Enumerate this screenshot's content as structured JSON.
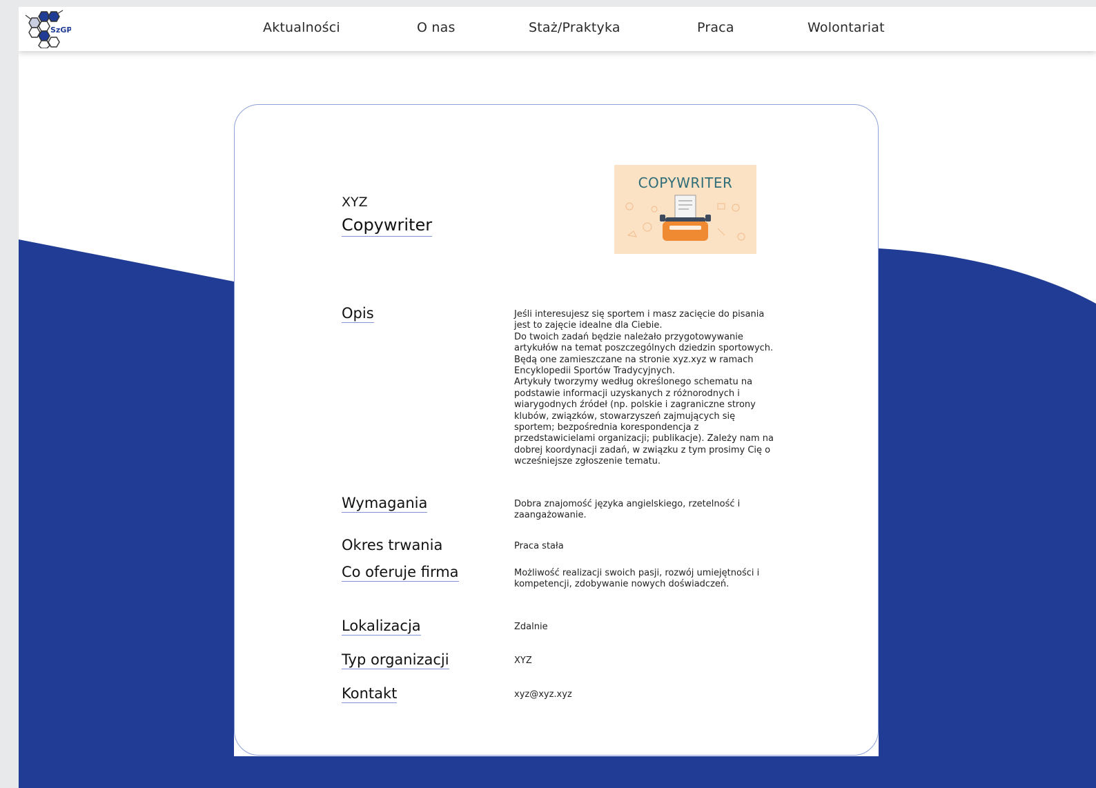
{
  "nav": {
    "logo_text": "SzGP",
    "items": [
      "Aktualności",
      "O nas",
      "Staż/Praktyka",
      "Praca",
      "Wolontariat"
    ]
  },
  "colors": {
    "brand_blue": "#203c94",
    "underline": "#7f93d4",
    "card_border": "#8fa0d8"
  },
  "offer": {
    "company": "XYZ",
    "title": "Copywriter",
    "image_text": "COPYWRITER",
    "sections": [
      {
        "label": "Opis",
        "value": "Jeśli interesujesz się sportem i masz zacięcie do pisania jest to zajęcie idealne dla Ciebie.\nDo twoich zadań będzie należało przygotowywanie artykułów na temat poszczególnych dziedzin sportowych. Będą one zamieszczane na stronie xyz.xyz w ramach Encyklopedii Sportów Tradycyjnych.\nArtykuły tworzymy według określonego schematu na podstawie informacji uzyskanych z różnorodnych i wiarygodnych źródeł (np. polskie i zagraniczne strony klubów, związków, stowarzyszeń zajmujących się sportem; bezpośrednia korespondencja z przedstawicielami organizacji; publikacje). Zależy nam na dobrej koordynacji zadań, w związku z tym prosimy Cię o wcześniejsze zgłoszenie tematu."
      },
      {
        "label": "Wymagania",
        "value": "Dobra znajomość języka angielskiego, rzetelność i zaangażowanie."
      },
      {
        "label": "Okres trwania",
        "value": "Praca stała"
      },
      {
        "label": "Co oferuje firma",
        "value": "Możliwość realizacji swoich pasji, rozwój umiejętności i kompetencji, zdobywanie nowych doświadczeń."
      },
      {
        "label": "Lokalizacja",
        "value": "Zdalnie"
      },
      {
        "label": "Typ organizacji",
        "value": "XYZ"
      },
      {
        "label": "Kontakt",
        "value": "xyz@xyz.xyz"
      }
    ]
  }
}
